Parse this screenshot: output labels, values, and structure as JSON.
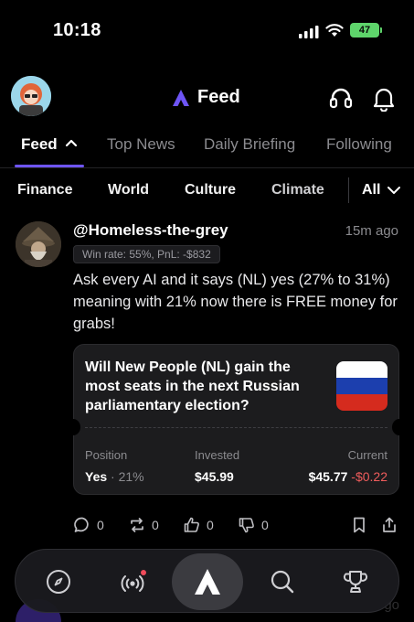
{
  "status_bar": {
    "time": "10:18",
    "battery": "47"
  },
  "header": {
    "title": "Feed",
    "logo_icon": "app-logo-icon",
    "support_icon": "headset-icon",
    "notifications_icon": "bell-icon"
  },
  "tabs": [
    {
      "label": "Feed",
      "active": true
    },
    {
      "label": "Top News",
      "active": false
    },
    {
      "label": "Daily Briefing",
      "active": false
    },
    {
      "label": "Following",
      "active": false
    }
  ],
  "categories": [
    "Finance",
    "World",
    "Culture",
    "Climate"
  ],
  "category_all": "All",
  "post": {
    "handle": "@Homeless-the-grey",
    "time": "15m ago",
    "winrate": "Win rate: 55%, PnL: -$832",
    "text": "Ask every AI and it says (NL) yes (27% to 31%) meaning with 21% now there is FREE money for grabs!",
    "market": {
      "question": "Will New People (NL) gain the most seats in the next Russian parliamentary election?",
      "flag_colors": [
        "#ffffff",
        "#1c3fae",
        "#d52b1e"
      ],
      "position_label": "Position",
      "position_side": "Yes",
      "position_sep": "·",
      "position_pct": "21%",
      "invested_label": "Invested",
      "invested_value": "$45.99",
      "current_label": "Current",
      "current_value": "$45.77",
      "current_change": "-$0.22"
    },
    "actions": {
      "comments": "0",
      "reposts": "0",
      "likes": "0",
      "dislikes": "0"
    }
  },
  "next_post": {
    "time": "go"
  },
  "nav": {
    "items": [
      "compass-icon",
      "live-icon",
      "app-logo-icon",
      "search-icon",
      "trophy-icon"
    ]
  },
  "colors": {
    "accent": "#6e55f5",
    "negative": "#ef5c5c",
    "background": "#000000",
    "card": "#1c1c1e"
  }
}
